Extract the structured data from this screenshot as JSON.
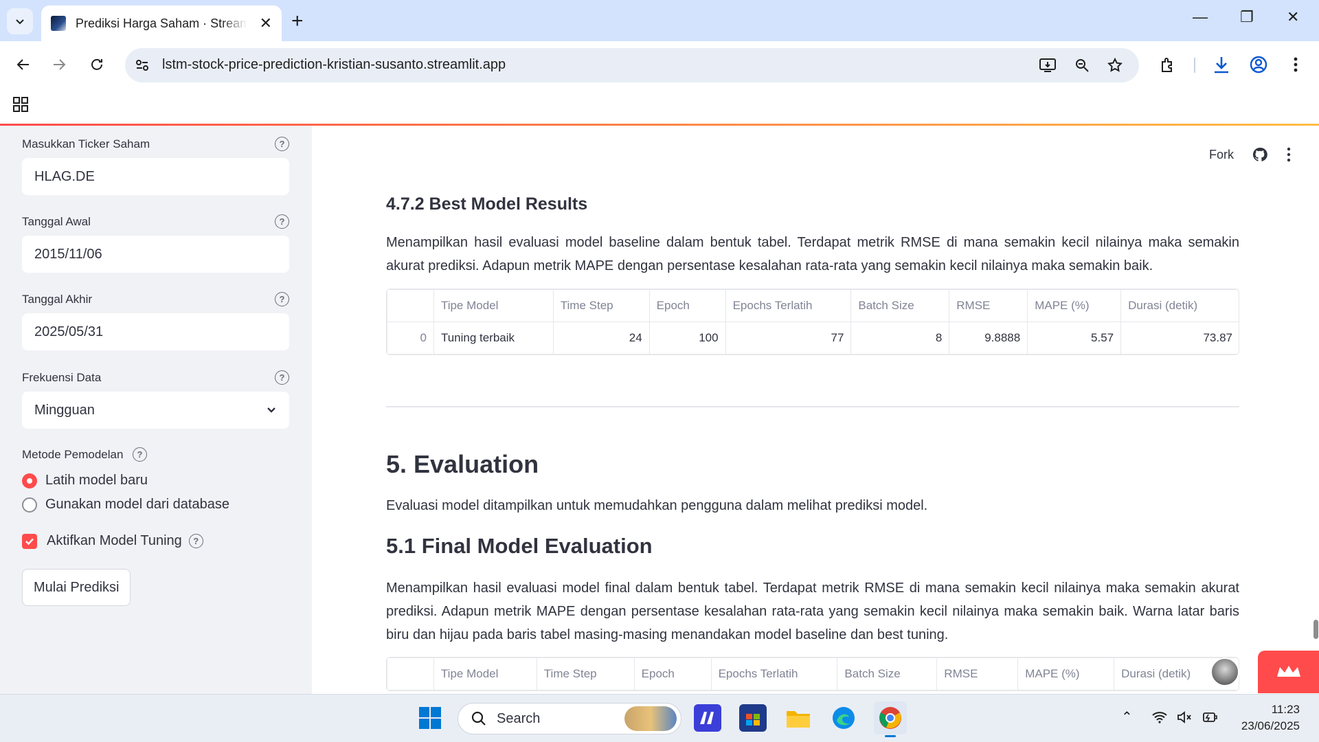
{
  "browser": {
    "tab_title": "Prediksi Harga Saham · Streamlit",
    "url": "lstm-stock-price-prediction-kristian-susanto.streamlit.app"
  },
  "sidebar": {
    "ticker_label": "Masukkan Ticker Saham",
    "ticker_value": "HLAG.DE",
    "start_label": "Tanggal Awal",
    "start_value": "2015/11/06",
    "end_label": "Tanggal Akhir",
    "end_value": "2025/05/31",
    "freq_label": "Frekuensi Data",
    "freq_value": "Mingguan",
    "method_label": "Metode Pemodelan",
    "method_options": [
      "Latih model baru",
      "Gunakan model dari database"
    ],
    "tuning_label": "Aktifkan Model Tuning",
    "predict_button": "Mulai Prediksi"
  },
  "header": {
    "fork_label": "Fork"
  },
  "main": {
    "best_title": "4.7.2 Best Model Results",
    "best_desc": "Menampilkan hasil evaluasi model baseline dalam bentuk tabel. Terdapat metrik RMSE di mana semakin kecil nilainya maka semakin akurat prediksi. Adapun metrik MAPE dengan persentase kesalahan rata-rata yang semakin kecil nilainya maka semakin baik.",
    "table_headers": [
      "",
      "Tipe Model",
      "Time Step",
      "Epoch",
      "Epochs Terlatih",
      "Batch Size",
      "RMSE",
      "MAPE (%)",
      "Durasi (detik)"
    ],
    "best_row": [
      "0",
      "Tuning terbaik",
      "24",
      "100",
      "77",
      "8",
      "9.8888",
      "5.57",
      "73.87"
    ],
    "eval_title": "5. Evaluation",
    "eval_desc": "Evaluasi model ditampilkan untuk memudahkan pengguna dalam melihat prediksi model.",
    "final_title": "5.1 Final Model Evaluation",
    "final_desc": "Menampilkan hasil evaluasi model final dalam bentuk tabel. Terdapat metrik RMSE di mana semakin kecil nilainya maka semakin akurat prediksi. Adapun metrik MAPE dengan persentase kesalahan rata-rata yang semakin kecil nilainya maka semakin baik. Warna latar baris biru dan hijau pada baris tabel masing-masing menandakan model baseline dan best tuning."
  },
  "taskbar": {
    "search_placeholder": "Search",
    "time": "11:23",
    "date": "23/06/2025"
  }
}
